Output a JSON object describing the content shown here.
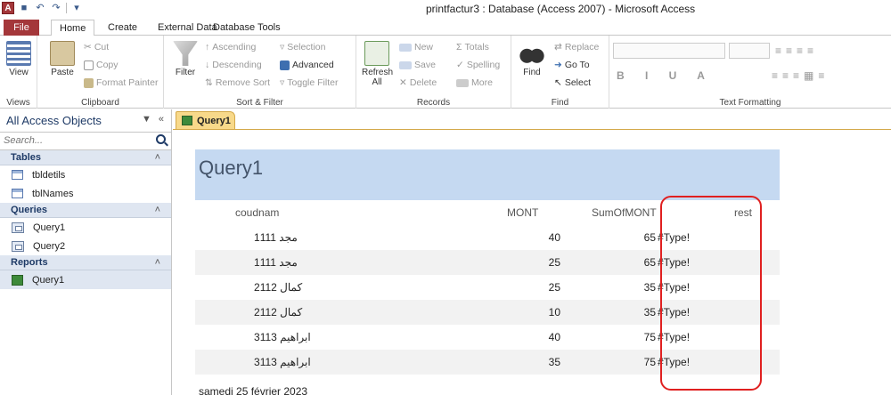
{
  "app": {
    "window_title": "printfactur3 : Database (Access 2007)  -  Microsoft Access",
    "app_icon_letter": "A"
  },
  "tabs": {
    "file": "File",
    "home": "Home",
    "create": "Create",
    "external_data": "External Data",
    "database_tools": "Database Tools"
  },
  "ribbon": {
    "views": {
      "view": "View",
      "label": "Views"
    },
    "clipboard": {
      "paste": "Paste",
      "cut": "Cut",
      "copy": "Copy",
      "format_painter": "Format Painter",
      "label": "Clipboard"
    },
    "sort_filter": {
      "filter": "Filter",
      "ascending": "Ascending",
      "descending": "Descending",
      "remove_sort": "Remove Sort",
      "selection": "Selection",
      "advanced": "Advanced",
      "toggle_filter": "Toggle Filter",
      "label": "Sort & Filter"
    },
    "records": {
      "refresh": "Refresh",
      "refresh_all": "All",
      "new": "New",
      "save": "Save",
      "delete": "Delete",
      "totals": "Totals",
      "spelling": "Spelling",
      "more": "More",
      "label": "Records"
    },
    "find": {
      "find": "Find",
      "replace": "Replace",
      "goto": "Go To",
      "select": "Select",
      "label": "Find"
    },
    "text_formatting": {
      "label": "Text Formatting"
    }
  },
  "nav": {
    "header": "All Access Objects",
    "search_placeholder": "Search...",
    "groups": [
      {
        "title": "Tables",
        "items": [
          "tbldetils",
          "tblNames"
        ]
      },
      {
        "title": "Queries",
        "items": [
          "Query1",
          "Query2"
        ]
      },
      {
        "title": "Reports",
        "items": [
          "Query1"
        ]
      }
    ]
  },
  "document": {
    "tab_label": "Query1",
    "report_title": "Query1",
    "headers": {
      "name": "coudnam",
      "mont": "MONT",
      "sum": "SumOfMONT",
      "rest": "rest"
    },
    "rows": [
      {
        "name": "1مجد 111",
        "mont": "40",
        "sum": "65",
        "rest": "#Type!"
      },
      {
        "name": "1مجد 111",
        "mont": "25",
        "sum": "65",
        "rest": "#Type!"
      },
      {
        "name": "2كمال 112",
        "mont": "25",
        "sum": "35",
        "rest": "#Type!"
      },
      {
        "name": "2كمال 112",
        "mont": "10",
        "sum": "35",
        "rest": "#Type!"
      },
      {
        "name": "3ابراهيم 113",
        "mont": "40",
        "sum": "75",
        "rest": "#Type!"
      },
      {
        "name": "3ابراهيم 113",
        "mont": "35",
        "sum": "75",
        "rest": "#Type!"
      }
    ],
    "footer_date": "samedi 25 février 2023"
  },
  "colors": {
    "file_tab": "#a4373a",
    "title_band": "#c5d9f1",
    "highlight_box": "#e02020",
    "doc_tab": "#f8d98a"
  }
}
